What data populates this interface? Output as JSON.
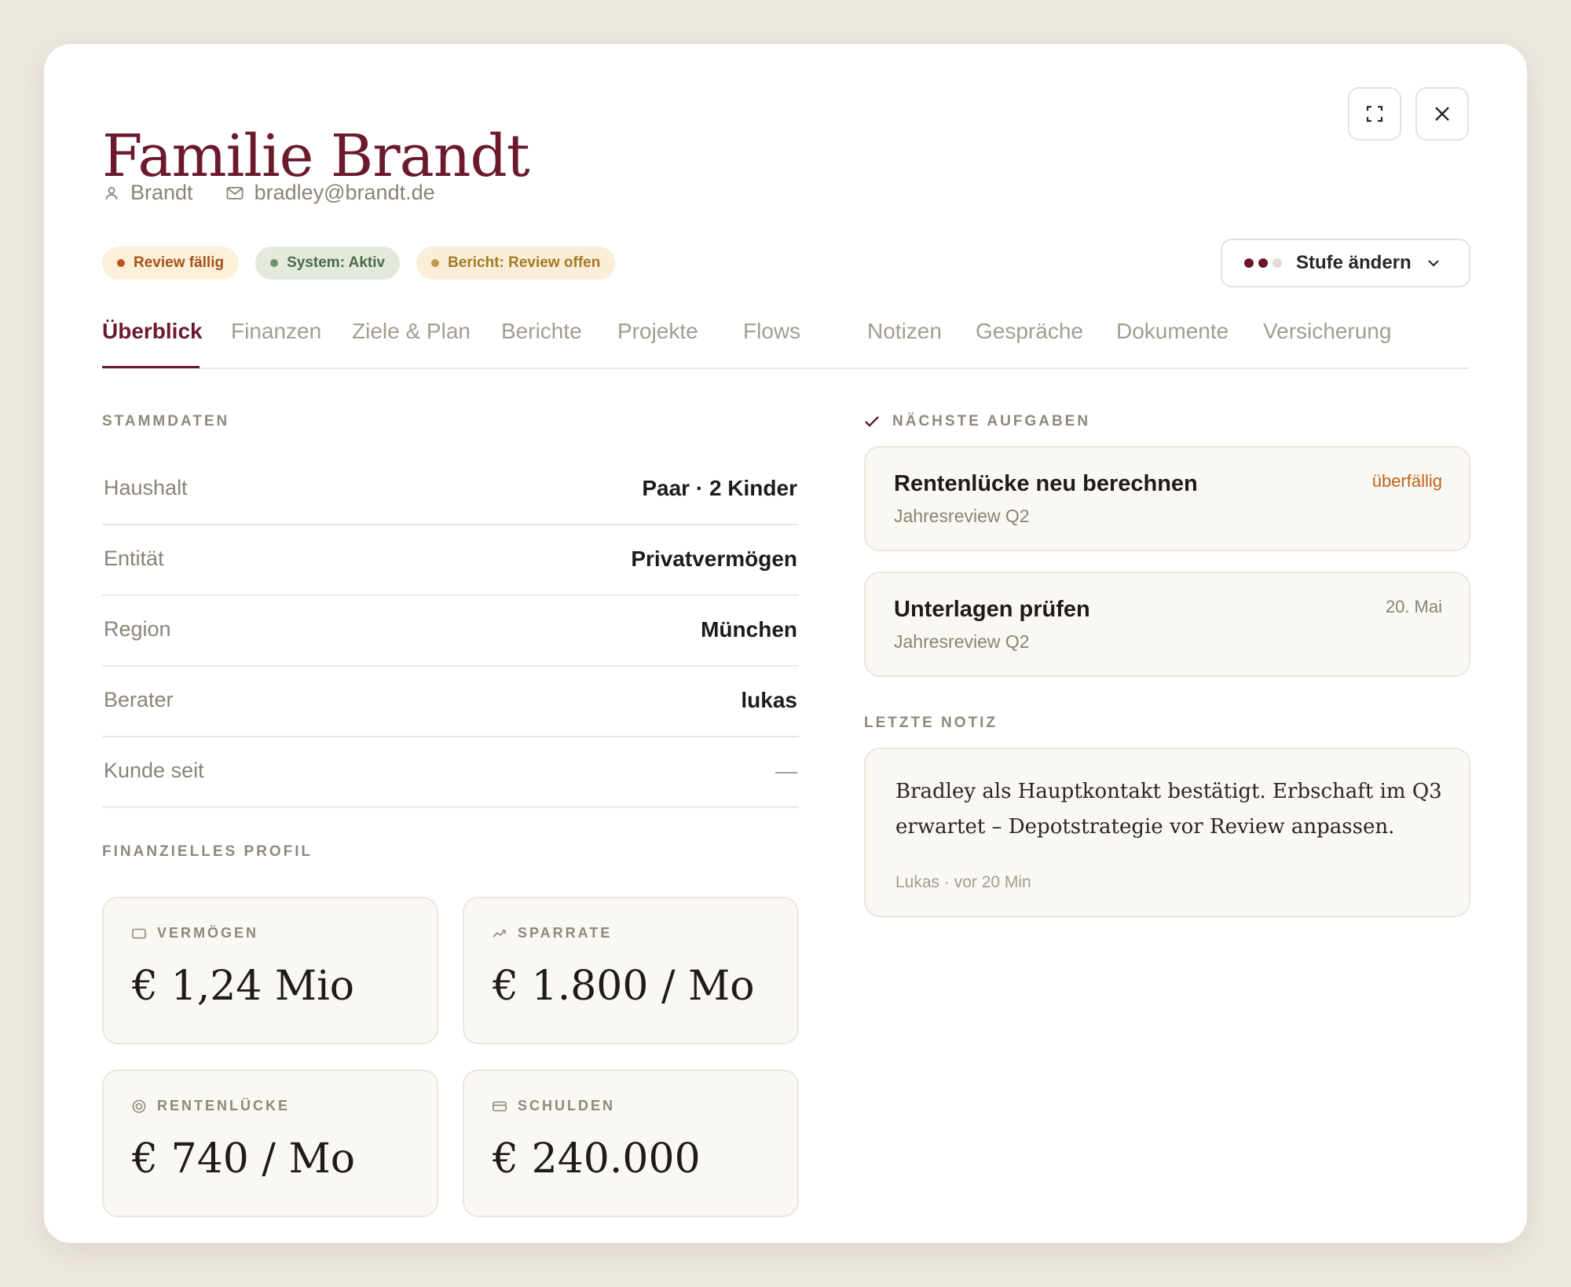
{
  "header": {
    "title": "Familie Brandt",
    "contact_name": "Brandt",
    "email": "bradley@brandt.de"
  },
  "window_controls": {
    "expand_icon": "expand-icon",
    "close_icon": "close-icon"
  },
  "badges": [
    {
      "label": "Review fällig",
      "bg": "#fdf0d9",
      "text": "#a3521c",
      "dot": "#b5541e"
    },
    {
      "label": "System: Aktiv",
      "bg": "#e3eadc",
      "text": "#4d6a48",
      "dot": "#6d9467"
    },
    {
      "label": "Bericht: Review offen",
      "bg": "#fbeed8",
      "text": "#a37a26",
      "dot": "#c29a4c"
    }
  ],
  "stage_button": {
    "label": "Stufe ändern",
    "filled_dots": 2,
    "total_dots": 3
  },
  "tabs": [
    "Überblick",
    "Finanzen",
    "Ziele & Plan",
    "Berichte",
    "Projekte",
    "Flows",
    "Notizen",
    "Gespräche",
    "Dokumente",
    "Versicherung"
  ],
  "stammdaten": {
    "title": "STAMMDATEN",
    "rows": [
      {
        "key": "Haushalt",
        "value": "Paar · 2 Kinder"
      },
      {
        "key": "Entität",
        "value": "Privatvermögen"
      },
      {
        "key": "Region",
        "value": "München"
      },
      {
        "key": "Berater",
        "value": "lukas"
      },
      {
        "key": "Kunde seit",
        "value": "—"
      }
    ]
  },
  "profil": {
    "title": "FINANZIELLES PROFIL",
    "cards": [
      {
        "label": "VERMÖGEN",
        "value": "€ 1,24 Mio",
        "icon": "wallet-icon"
      },
      {
        "label": "SPARRATE",
        "value": "€ 1.800 / Mo",
        "icon": "trend-up-icon"
      },
      {
        "label": "RENTENLÜCKE",
        "value": "€ 740 / Mo",
        "icon": "target-icon"
      },
      {
        "label": "SCHULDEN",
        "value": "€ 240.000",
        "icon": "credit-card-icon"
      }
    ]
  },
  "aufgaben": {
    "title": "NÄCHSTE AUFGABEN",
    "items": [
      {
        "title": "Rentenlücke neu berechnen",
        "subtitle": "Jahresreview Q2",
        "meta": "überfällig",
        "meta_color": "#c0621a"
      },
      {
        "title": "Unterlagen prüfen",
        "subtitle": "Jahresreview Q2",
        "meta": "20. Mai",
        "meta_color": "#8a8376"
      }
    ]
  },
  "notiz": {
    "title": "LETZTE NOTIZ",
    "text": "Bradley als Hauptkontakt bestätigt. Erbschaft im Q3 erwartet – Depotstrategie vor Review anpassen.",
    "byline": "Lukas · vor 20 Min"
  },
  "colors": {
    "accent": "#6b1a2c",
    "background": "#ede8df"
  }
}
